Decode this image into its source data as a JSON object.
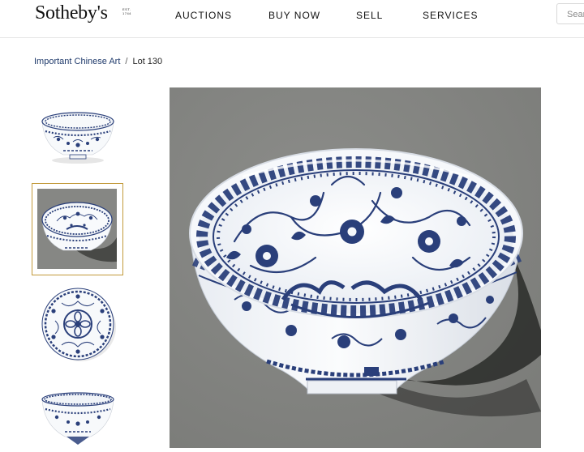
{
  "header": {
    "logo_text": "Sotheby's",
    "logo_est": "EST. 1744",
    "nav": [
      "AUCTIONS",
      "BUY NOW",
      "SELL",
      "SERVICES"
    ],
    "search_placeholder": "Search"
  },
  "breadcrumb": {
    "parent": "Important Chinese Art",
    "separator": "/",
    "current": "Lot 130"
  },
  "gallery": {
    "thumbnails": [
      {
        "view": "side view",
        "selected": false
      },
      {
        "view": "side view with shadow",
        "selected": true
      },
      {
        "view": "top view",
        "selected": false
      },
      {
        "view": "base view",
        "selected": false
      }
    ],
    "background_color": "#868784",
    "accent_color": "#c29a3a",
    "glaze_color": "#f7f9fb",
    "cobalt_color": "#2a3f7a"
  }
}
